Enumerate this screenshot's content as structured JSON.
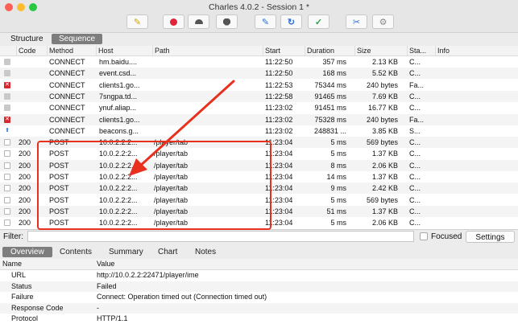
{
  "window": {
    "title": "Charles 4.0.2 - Session 1 *"
  },
  "view_tabs": {
    "structure": "Structure",
    "sequence": "Sequence"
  },
  "table": {
    "headers": [
      "Code",
      "Method",
      "Host",
      "Path",
      "Start",
      "Duration",
      "Size",
      "Sta...",
      "Info"
    ],
    "rows": [
      {
        "status_icon": "lock-icon",
        "code": "",
        "method": "CONNECT",
        "host": "hm.baidu....",
        "path": "",
        "start": "11:22:50",
        "duration": "357 ms",
        "size": "2.13 KB",
        "status": "C..."
      },
      {
        "status_icon": "lock-icon",
        "code": "",
        "method": "CONNECT",
        "host": "event.csd...",
        "path": "",
        "start": "11:22:50",
        "duration": "168 ms",
        "size": "5.52 KB",
        "status": "C..."
      },
      {
        "status_icon": "error-icon",
        "code": "",
        "method": "CONNECT",
        "host": "clients1.go...",
        "path": "",
        "start": "11:22:53",
        "duration": "75344 ms",
        "size": "240 bytes",
        "status": "Fa..."
      },
      {
        "status_icon": "lock-icon",
        "code": "",
        "method": "CONNECT",
        "host": "7sngpa.td...",
        "path": "",
        "start": "11:22:58",
        "duration": "91465 ms",
        "size": "7.69 KB",
        "status": "C..."
      },
      {
        "status_icon": "lock-icon",
        "code": "",
        "method": "CONNECT",
        "host": "ynuf.aliap...",
        "path": "",
        "start": "11:23:02",
        "duration": "91451 ms",
        "size": "16.77 KB",
        "status": "C..."
      },
      {
        "status_icon": "error-icon",
        "code": "",
        "method": "CONNECT",
        "host": "clients1.go...",
        "path": "",
        "start": "11:23:02",
        "duration": "75328 ms",
        "size": "240 bytes",
        "status": "Fa..."
      },
      {
        "status_icon": "upload-arrow-icon",
        "code": "",
        "method": "CONNECT",
        "host": "beacons.g...",
        "path": "",
        "start": "11:23:02",
        "duration": "248831 ...",
        "size": "3.85 KB",
        "status": "S..."
      },
      {
        "status_icon": "document-icon",
        "code": "200",
        "method": "POST",
        "host": "10.0.2.2:2...",
        "path": "/player/tab",
        "start": "11:23:04",
        "duration": "5 ms",
        "size": "569 bytes",
        "status": "C..."
      },
      {
        "status_icon": "document-icon",
        "code": "200",
        "method": "POST",
        "host": "10.0.2.2:2...",
        "path": "/player/tab",
        "start": "11:23:04",
        "duration": "5 ms",
        "size": "1.37 KB",
        "status": "C..."
      },
      {
        "status_icon": "document-icon",
        "code": "200",
        "method": "POST",
        "host": "10.0.2.2:2...",
        "path": "/player/tab",
        "start": "11:23:04",
        "duration": "8 ms",
        "size": "2.06 KB",
        "status": "C..."
      },
      {
        "status_icon": "document-icon",
        "code": "200",
        "method": "POST",
        "host": "10.0.2.2:2...",
        "path": "/player/tab",
        "start": "11:23:04",
        "duration": "14 ms",
        "size": "1.37 KB",
        "status": "C..."
      },
      {
        "status_icon": "document-icon",
        "code": "200",
        "method": "POST",
        "host": "10.0.2.2:2...",
        "path": "/player/tab",
        "start": "11:23:04",
        "duration": "9 ms",
        "size": "2.42 KB",
        "status": "C..."
      },
      {
        "status_icon": "document-icon",
        "code": "200",
        "method": "POST",
        "host": "10.0.2.2:2...",
        "path": "/player/tab",
        "start": "11:23:04",
        "duration": "5 ms",
        "size": "569 bytes",
        "status": "C..."
      },
      {
        "status_icon": "document-icon",
        "code": "200",
        "method": "POST",
        "host": "10.0.2.2:2...",
        "path": "/player/tab",
        "start": "11:23:04",
        "duration": "51 ms",
        "size": "1.37 KB",
        "status": "C..."
      },
      {
        "status_icon": "document-icon",
        "code": "200",
        "method": "POST",
        "host": "10.0.2.2:2...",
        "path": "/player/tab",
        "start": "11:23:04",
        "duration": "5 ms",
        "size": "2.06 KB",
        "status": "C..."
      }
    ]
  },
  "filter": {
    "label": "Filter:",
    "value": "",
    "focused_label": "Focused",
    "focused_checked": false,
    "settings_label": "Settings"
  },
  "detail_tabs": [
    "Overview",
    "Contents",
    "Summary",
    "Chart",
    "Notes"
  ],
  "detail": {
    "headers": [
      "Name",
      "Value"
    ],
    "rows": [
      {
        "name": "URL",
        "value": "http://10.0.2.2:22471/player/ime"
      },
      {
        "name": "Status",
        "value": "Failed"
      },
      {
        "name": "Failure",
        "value": "Connect: Operation timed out (Connection timed out)"
      },
      {
        "name": "Response Code",
        "value": "-"
      },
      {
        "name": "Protocol",
        "value": "HTTP/1.1"
      }
    ]
  },
  "colors": {
    "annotation": "#e8301f",
    "selected_tab": "#7d7d7d",
    "error": "#d7282f",
    "upload": "#2d7bd6"
  }
}
